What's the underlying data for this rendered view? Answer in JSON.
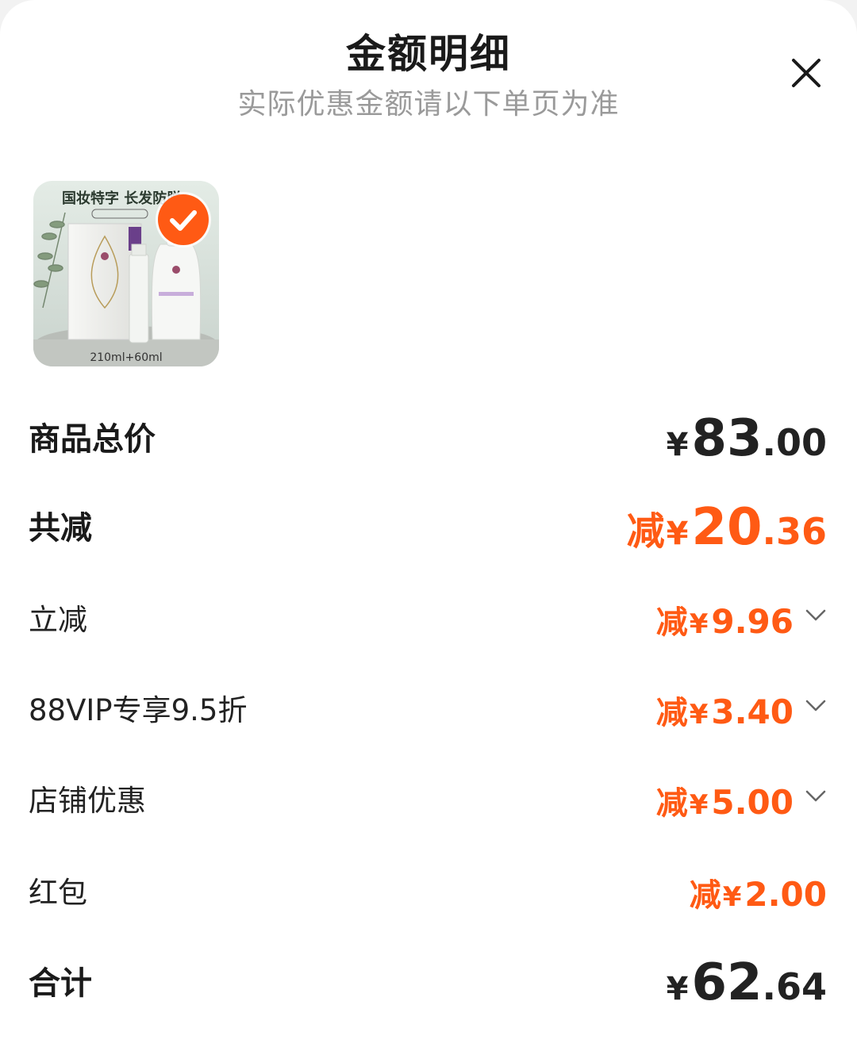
{
  "header": {
    "title": "金额明细",
    "subtitle": "实际优惠金额请以下单页为准"
  },
  "product": {
    "image_headline": "国妆特字 长发防脱",
    "image_caption": "210ml+60ml",
    "selected": true
  },
  "rows": {
    "total_price": {
      "label": "商品总价",
      "yen": "¥",
      "int": "83",
      "dec": ".00"
    },
    "total_discount": {
      "label": "共减",
      "prefix": "减",
      "yen": "¥",
      "int": "20",
      "dec": ".36"
    },
    "instant_discount": {
      "label": "立减",
      "prefix": "减",
      "yen": "¥",
      "amount": "9.96"
    },
    "vip_discount": {
      "label": "88VIP专享9.5折",
      "prefix": "减",
      "yen": "¥",
      "amount": "3.40"
    },
    "store_discount": {
      "label": "店铺优惠",
      "prefix": "减",
      "yen": "¥",
      "amount": "5.00"
    },
    "red_packet": {
      "label": "红包",
      "prefix": "减",
      "yen": "¥",
      "amount": "2.00"
    },
    "grand_total": {
      "label": "合计",
      "yen": "¥",
      "int": "62",
      "dec": ".64"
    }
  },
  "colors": {
    "accent": "#ff5a14",
    "text": "#222222",
    "subtle": "#9a9a9a"
  },
  "icons": {
    "close": "close-icon",
    "check": "check-icon",
    "chevron": "chevron-down-icon"
  }
}
